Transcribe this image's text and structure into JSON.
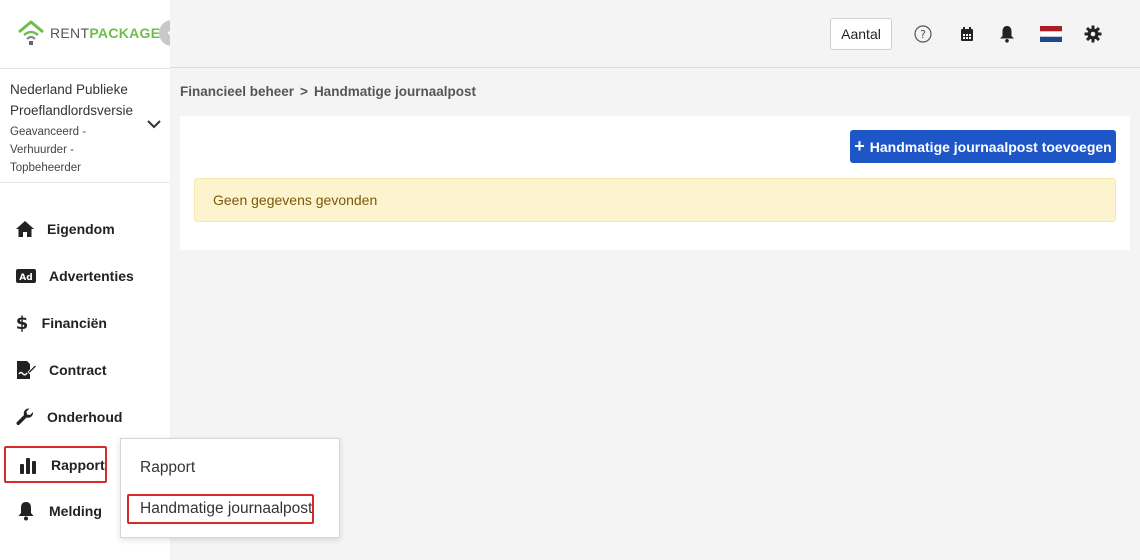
{
  "brand": {
    "rent": "RENT",
    "package": "PACKAGE"
  },
  "account": {
    "name": "Nederland Publieke Proeflandlordsversie",
    "role": "Geavanceerd - Verhuurder - Topbeheerder"
  },
  "sidebar": {
    "items": [
      {
        "label": "Eigendom",
        "icon": "home-icon"
      },
      {
        "label": "Advertenties",
        "icon": "ad-icon"
      },
      {
        "label": "Financiën",
        "icon": "dollar-icon"
      },
      {
        "label": "Contract",
        "icon": "contract-icon"
      },
      {
        "label": "Onderhoud",
        "icon": "wrench-icon"
      },
      {
        "label": "Rapport",
        "icon": "bar-chart-icon"
      },
      {
        "label": "Melding",
        "icon": "bell-icon"
      }
    ]
  },
  "topbar": {
    "aantal_label": "Aantal"
  },
  "breadcrumb": {
    "parent": "Financieel beheer",
    "separator": ">",
    "current": "Handmatige journaalpost"
  },
  "main": {
    "add_button_label": "Handmatige journaalpost toevoegen",
    "empty_message": "Geen gegevens gevonden"
  },
  "submenu": {
    "items": [
      {
        "label": "Rapport"
      },
      {
        "label": "Handmatige journaalpost"
      }
    ]
  },
  "colors": {
    "accent": "#1e56c7",
    "brand_green": "#6cc04a",
    "highlight_red": "#d42a2a",
    "alert_bg": "#fdf3cf"
  }
}
